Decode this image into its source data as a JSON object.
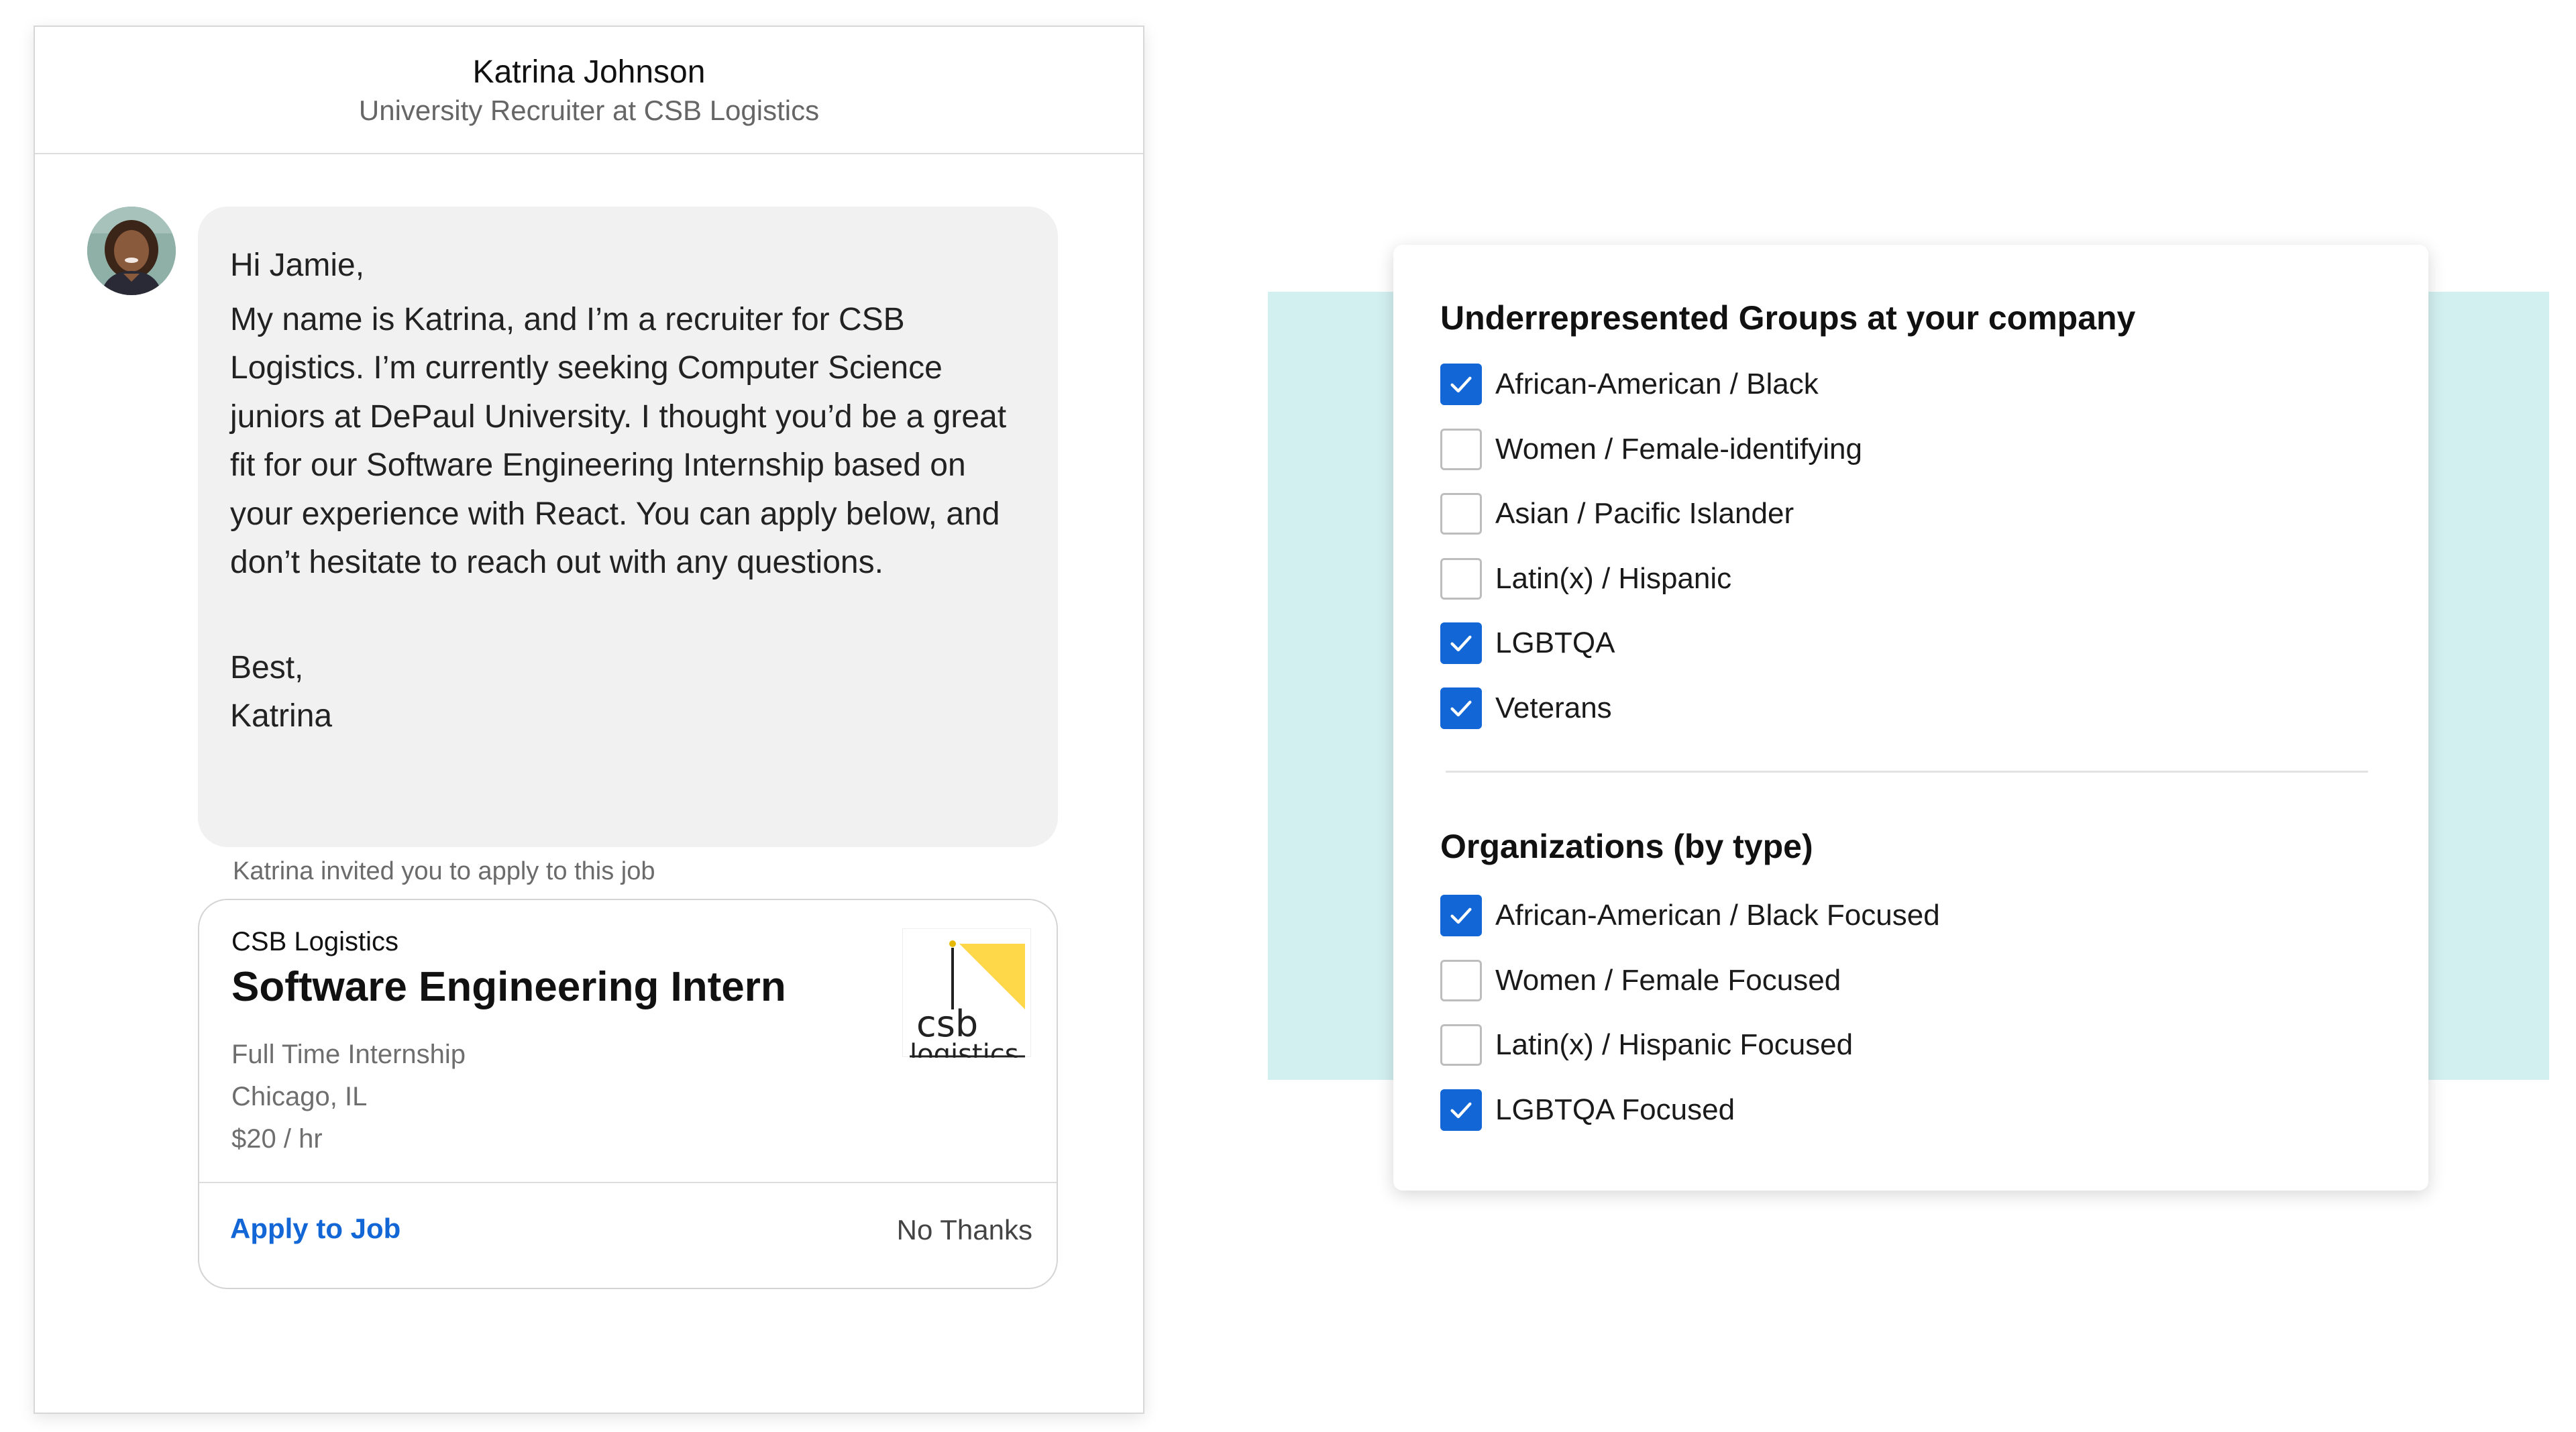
{
  "message": {
    "sender_name": "Katrina Johnson",
    "sender_title": "University Recruiter at CSB Logistics",
    "greeting": "Hi Jamie,",
    "body": "My name is Katrina, and I’m a recruiter for CSB Logistics. I’m currently seeking Computer Science juniors at DePaul University. I thought you’d be a great fit for our Software Engineering Internship based on your experience with React. You can apply below, and don’t hesitate to reach out with any questions.",
    "closing": "Best,",
    "signature": "Katrina",
    "invite_caption": "Katrina invited you to apply to this job"
  },
  "job": {
    "company": "CSB Logistics",
    "title": "Software Engineering Intern",
    "type": "Full Time Internship",
    "location": "Chicago, IL",
    "pay": "$20 / hr",
    "logo_text_top": "csb",
    "logo_text_bottom": "logistics",
    "apply_label": "Apply to Job",
    "decline_label": "No Thanks"
  },
  "filters": {
    "section1_title": "Underrepresented Groups at your company",
    "section1_options": [
      {
        "label": "African-American / Black",
        "checked": true
      },
      {
        "label": "Women / Female-identifying",
        "checked": false
      },
      {
        "label": "Asian / Pacific Islander",
        "checked": false
      },
      {
        "label": "Latin(x) / Hispanic",
        "checked": false
      },
      {
        "label": "LGBTQA",
        "checked": true
      },
      {
        "label": "Veterans",
        "checked": true
      }
    ],
    "section2_title": "Organizations (by type)",
    "section2_options": [
      {
        "label": "African-American / Black Focused",
        "checked": true
      },
      {
        "label": "Women / Female Focused",
        "checked": false
      },
      {
        "label": "Latin(x) / Hispanic Focused",
        "checked": false
      },
      {
        "label": "LGBTQA Focused",
        "checked": true
      }
    ]
  },
  "colors": {
    "accent_blue": "#1266d6",
    "accent_teal_bg": "#d3f0f0",
    "logo_yellow": "#ffd84a"
  }
}
